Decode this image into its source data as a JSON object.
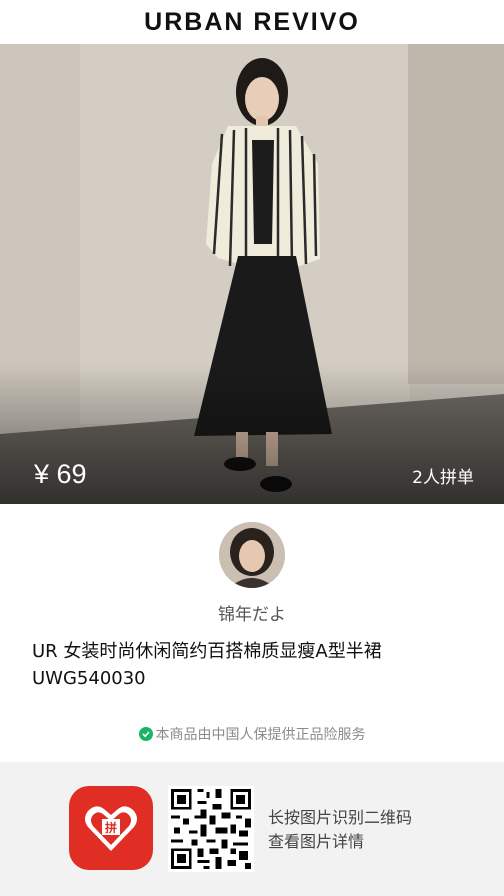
{
  "header": {
    "brand": "URBAN REVIVO"
  },
  "hero": {
    "image": "product-photo-woman-striped-shirt-black-skirt",
    "price": "¥ 69",
    "group_buy": "2人拼单"
  },
  "seller": {
    "avatar": "user-avatar-photo",
    "name": "锦年だよ"
  },
  "product": {
    "title_line1": "UR 女装时尚休闲简约百搭棉质显瘦A型半裙",
    "title_line2": "UWG540030"
  },
  "guarantee": {
    "icon": "shield-check-icon",
    "text": "本商品由中国人保提供正品险服务",
    "color": "#18b566"
  },
  "footer": {
    "app_icon": "pinduoduo-app-icon",
    "qr": "qr-code",
    "scan_line1": "长按图片识别二维码",
    "scan_line2": "查看图片详情",
    "app_color": "#e02e24"
  }
}
